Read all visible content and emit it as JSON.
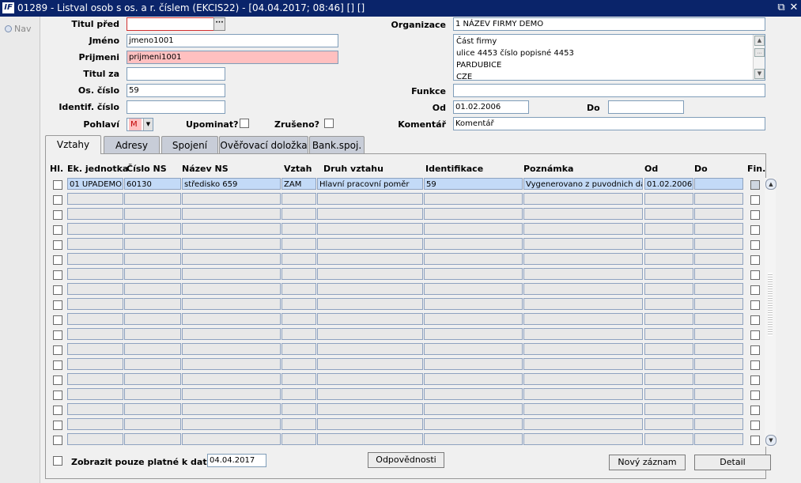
{
  "window": {
    "icon_text": "IF",
    "title": "01289 - Listval osob s os. a r. číslem (EKCIS22) - [04.04.2017; 08:46] [] []",
    "restore_glyph": "⧉",
    "close_glyph": "✕"
  },
  "nav": {
    "label": "Nav"
  },
  "form": {
    "titul_pred": {
      "label": "Titul před",
      "value": ""
    },
    "ellipsis": "···",
    "jmeno": {
      "label": "Jméno",
      "value": "jmeno1001"
    },
    "prijmeni": {
      "label": "Prijmeni",
      "value": "prijmeni1001"
    },
    "titul_za": {
      "label": "Titul za",
      "value": ""
    },
    "os_cislo": {
      "label": "Os. číslo",
      "value": "59"
    },
    "identif_cislo": {
      "label": "Identif. číslo",
      "value": ""
    },
    "pohlavi": {
      "label": "Pohlaví",
      "value": "M"
    },
    "upominat": {
      "label": "Upominat?",
      "checked": false
    },
    "zruseno": {
      "label": "Zrušeno?",
      "checked": false
    },
    "organizace": {
      "label": "Organizace",
      "value": "1 NÁZEV FIRMY DEMO"
    },
    "address_lines": [
      "Část firmy",
      "ulice 4453 číslo popisné 4453",
      "PARDUBICE",
      "CZE"
    ],
    "funkce": {
      "label": "Funkce",
      "value": ""
    },
    "od": {
      "label": "Od",
      "value": "01.02.2006"
    },
    "do": {
      "label": "Do",
      "value": ""
    },
    "komentar": {
      "label": "Komentář",
      "value": "Komentář"
    }
  },
  "tabs": [
    {
      "label": "Vztahy",
      "active": true
    },
    {
      "label": "Adresy",
      "active": false
    },
    {
      "label": "Spojení",
      "active": false
    },
    {
      "label": "Ověřovací doložka",
      "active": false
    },
    {
      "label": "Bank.spoj.",
      "active": false
    }
  ],
  "grid": {
    "columns": [
      "Hl.",
      "Ek. jednotka",
      "Číslo NS",
      "Název NS",
      "Vztah",
      "Druh vztahu",
      "Identifikace",
      "Poznámka",
      "Od",
      "Do",
      "Fin."
    ],
    "rows": [
      {
        "hl": false,
        "ek": "01 UPADEMO",
        "cislo_ns": "60130",
        "nazev_ns": "středisko 659",
        "vztah": "ZAM",
        "druh": "Hlavní pracovní poměr",
        "ident": "59",
        "poznamka": "Vygenerovano z puvodnich dat",
        "od": "01.02.2006",
        "do": "",
        "fin": true
      }
    ],
    "visible_rows": 18
  },
  "footer": {
    "only_valid_label": "Zobrazit pouze platné k datu :",
    "date_value": "04.04.2017",
    "odpovednosti": "Odpovědnosti",
    "novy_zaznam": "Nový záznam",
    "detail": "Detail"
  }
}
